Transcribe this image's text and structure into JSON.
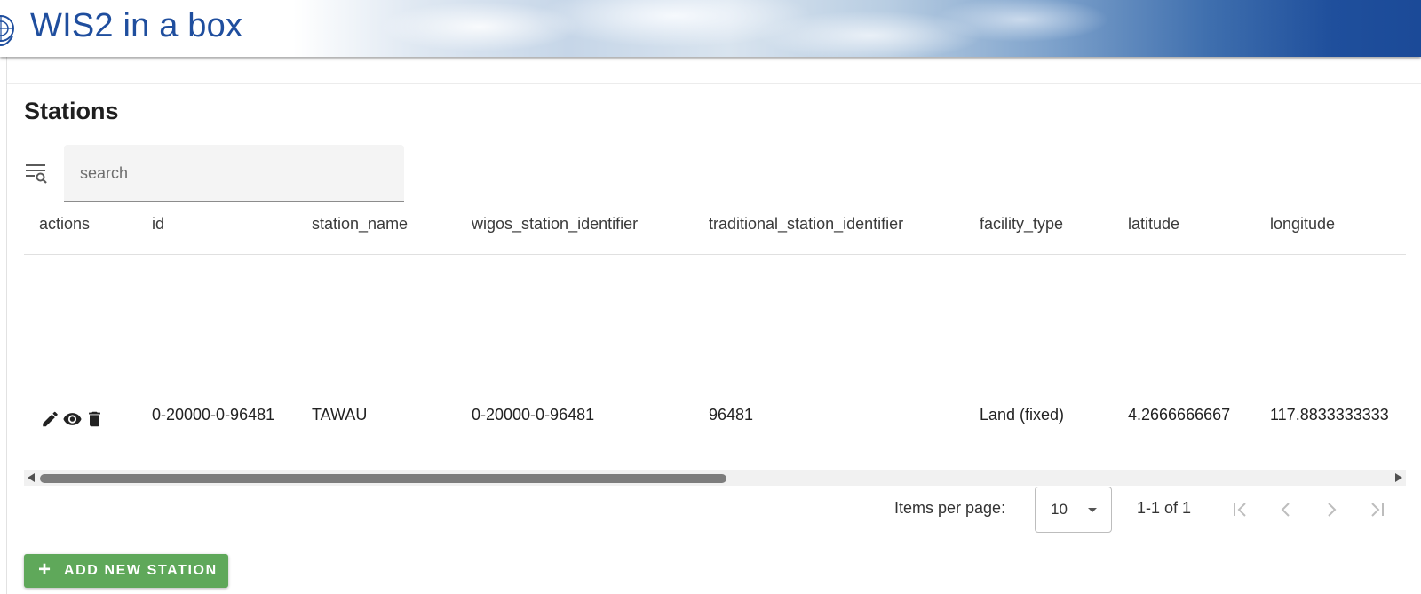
{
  "header": {
    "app_title": "WIS2 in a box",
    "logo_icon": "wmo-emblem-icon"
  },
  "page": {
    "title": "Stations"
  },
  "search": {
    "placeholder": "search",
    "value": ""
  },
  "table": {
    "columns": [
      "actions",
      "id",
      "station_name",
      "wigos_station_identifier",
      "traditional_station_identifier",
      "facility_type",
      "latitude",
      "longitude"
    ],
    "rows": [
      {
        "id": "0-20000-0-96481",
        "station_name": "TAWAU",
        "wigos_station_identifier": "0-20000-0-96481",
        "traditional_station_identifier": "96481",
        "facility_type": "Land (fixed)",
        "latitude": "4.2666666667",
        "longitude": "117.8833333333"
      }
    ],
    "row_actions": [
      "edit-icon",
      "view-icon",
      "delete-icon"
    ]
  },
  "paginator": {
    "items_per_page_label": "Items per page:",
    "items_per_page_value": "10",
    "range_label": "1-1 of 1"
  },
  "add_button": {
    "label": "ADD NEW STATION",
    "color": "#5fa85a"
  },
  "colors": {
    "brand_blue": "#1f4e9e",
    "header_gradient_end": "#1b4a98"
  }
}
